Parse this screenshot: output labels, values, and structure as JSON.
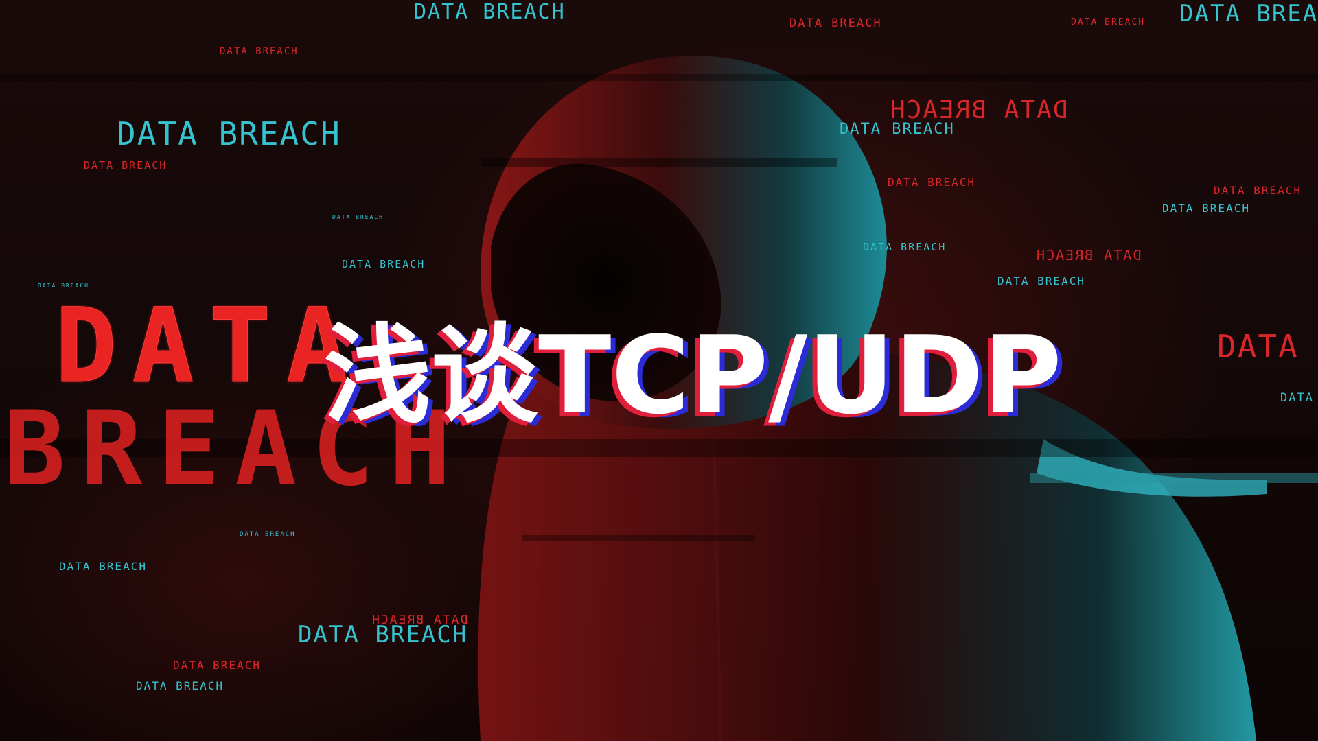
{
  "title_overlay": "浅谈TCP/UDP",
  "big_text": {
    "line1": "DATA",
    "line2": "BREACH"
  },
  "overlay_texts": [
    "DATA BREACH",
    "DATA BREACH",
    "DATA BREACH",
    "DATA BREACH",
    "DATA BREACH",
    "DATA BREACH",
    "DATA BREACH",
    "DATA BREACH",
    "DATA BREACH",
    "DATA BREACH",
    "DATA BREACH",
    "DATA BREACH",
    "DATA BREACH",
    "DATA BREACH",
    "DATA BREACH",
    "DATA BREACH",
    "DATA BREACH",
    "DATA BREACH",
    "DATA BREACH",
    "DATA BREACH",
    "DATA BREACH",
    "DATA BREACH",
    "DATA BREACH",
    "DATA BREACH",
    "DATA",
    "DATA B"
  ],
  "colors": {
    "accent_cyan": "#35c4cf",
    "accent_red": "#d8262a",
    "title_shadow_red": "#e01f3d",
    "title_shadow_blue": "#2b2cd6"
  },
  "scene_subject": "hooded-figure-illustration"
}
